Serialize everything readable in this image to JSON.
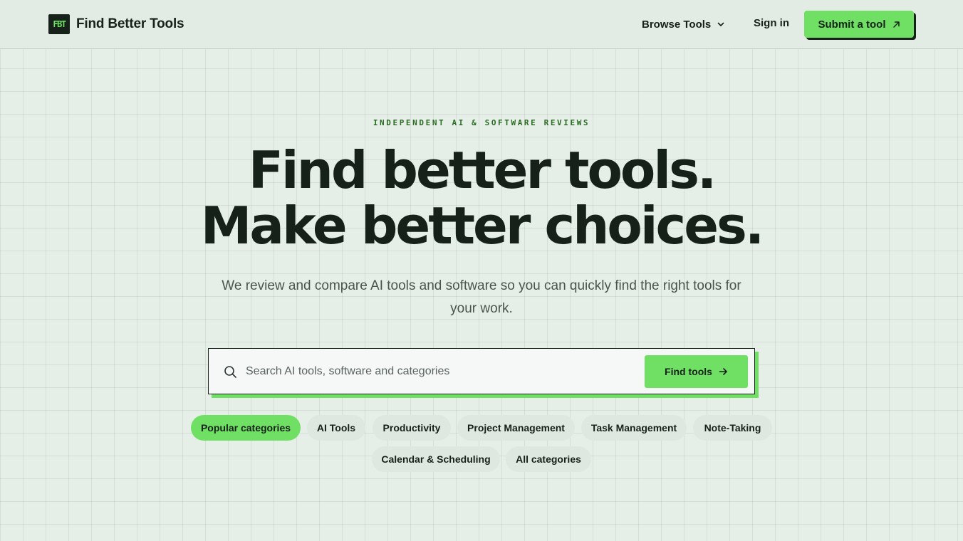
{
  "header": {
    "logo_text": "FBT",
    "brand_name": "Find Better Tools",
    "nav": {
      "browse_label": "Browse Tools",
      "signin_label": "Sign in",
      "submit_label": "Submit a tool"
    }
  },
  "hero": {
    "eyebrow": "INDEPENDENT AI & SOFTWARE REVIEWS",
    "headline_line1": "Find better tools.",
    "headline_line2": "Make better choices.",
    "subtitle": "We review and compare AI tools and software so you can quickly find the right tools for your work."
  },
  "search": {
    "placeholder": "Search AI tools, software and categories",
    "value": "",
    "button_label": "Find tools"
  },
  "categories": {
    "items": [
      {
        "label": "Popular categories",
        "active": true
      },
      {
        "label": "AI Tools"
      },
      {
        "label": "Productivity"
      },
      {
        "label": "Project Management"
      },
      {
        "label": "Task Management"
      },
      {
        "label": "Note-Taking"
      },
      {
        "label": "Calendar & Scheduling"
      },
      {
        "label": "All categories"
      }
    ]
  },
  "colors": {
    "accent": "#6fe063",
    "ink": "#16211a",
    "background": "#e6eee8",
    "eyebrow": "#2b6b23"
  },
  "icons": {
    "browse_chevron": "chevron-down-icon",
    "submit_arrow": "arrow-up-right-icon",
    "search": "search-icon",
    "find_arrow": "arrow-right-icon"
  }
}
